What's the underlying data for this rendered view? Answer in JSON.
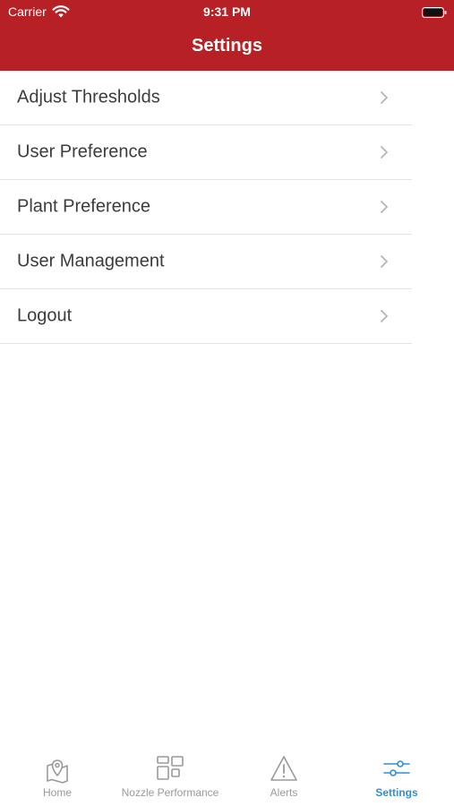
{
  "status_bar": {
    "carrier": "Carrier",
    "time": "9:31 PM"
  },
  "nav": {
    "title": "Settings",
    "background_color": "#b72025"
  },
  "settings_items": [
    {
      "label": "Adjust Thresholds"
    },
    {
      "label": "User Preference"
    },
    {
      "label": "Plant Preference"
    },
    {
      "label": "User Management"
    },
    {
      "label": "Logout"
    }
  ],
  "tab_bar": {
    "active_color": "#2f8fd8",
    "inactive_color": "#9a9a9a",
    "tabs": [
      {
        "label": "Home",
        "icon": "map-pin-icon",
        "active": false
      },
      {
        "label": "Nozzle Performance",
        "icon": "grid-icon",
        "active": false
      },
      {
        "label": "Alerts",
        "icon": "warning-icon",
        "active": false
      },
      {
        "label": "Settings",
        "icon": "sliders-icon",
        "active": true
      }
    ]
  }
}
